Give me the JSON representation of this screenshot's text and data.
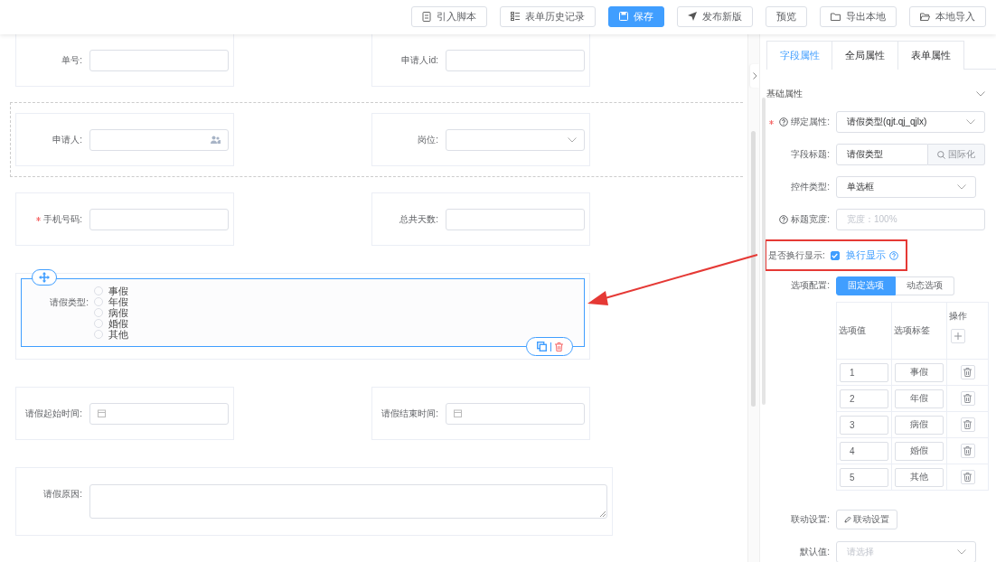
{
  "toolbar": {
    "buttons": [
      {
        "label": "引入脚本",
        "kind": "script",
        "primary": false
      },
      {
        "label": "表单历史记录",
        "kind": "history",
        "primary": false
      },
      {
        "label": "保存",
        "kind": "save",
        "primary": true
      },
      {
        "label": "发布新版",
        "kind": "publish",
        "primary": false
      },
      {
        "label": "预览",
        "kind": "none",
        "primary": false
      },
      {
        "label": "导出本地",
        "kind": "folder",
        "primary": false
      },
      {
        "label": "本地导入",
        "kind": "folder-open",
        "primary": false
      }
    ]
  },
  "canvas": {
    "rows": [
      {
        "kind": "row",
        "fields": [
          {
            "label": "单号:",
            "required": false,
            "kind": "input",
            "selected": false
          },
          {
            "label": "申请人id:",
            "required": false,
            "kind": "input",
            "selected": false
          }
        ]
      },
      {
        "kind": "container",
        "fields": [
          {
            "label": "申请人:",
            "required": false,
            "kind": "user",
            "selected": false
          },
          {
            "label": "岗位:",
            "required": false,
            "kind": "select",
            "selected": false
          }
        ]
      },
      {
        "kind": "row",
        "fields": [
          {
            "label": "手机号码:",
            "required": true,
            "kind": "input",
            "selected": false
          },
          {
            "label": "总共天数:",
            "required": false,
            "kind": "input",
            "selected": false
          }
        ]
      },
      {
        "kind": "row",
        "fields": [
          {
            "label": "请假类型:",
            "required": false,
            "kind": "radio",
            "selected": true,
            "options": [
              {
                "label": "事假",
                "checked": false
              },
              {
                "label": "年假",
                "checked": false
              },
              {
                "label": "病假",
                "checked": false
              },
              {
                "label": "婚假",
                "checked": false
              },
              {
                "label": "其他",
                "checked": false
              }
            ]
          }
        ]
      },
      {
        "kind": "row",
        "fields": [
          {
            "label": "请假起始时间:",
            "required": false,
            "kind": "date",
            "selected": false
          },
          {
            "label": "请假结束时间:",
            "required": false,
            "kind": "date",
            "selected": false
          }
        ]
      },
      {
        "kind": "row",
        "fields": [
          {
            "label": "请假原因:",
            "required": false,
            "kind": "textarea",
            "selected": false
          }
        ]
      }
    ]
  },
  "panel": {
    "tabs": [
      {
        "label": "字段属性",
        "selected": true
      },
      {
        "label": "全局属性",
        "selected": false
      },
      {
        "label": "表单属性",
        "selected": false
      }
    ],
    "section": {
      "title": "基础属性",
      "expanded": true
    },
    "props": [
      {
        "kind": "select",
        "label": "绑定属性:",
        "required": true,
        "help": true,
        "value": "请假类型(qjt.qj_qjlx)"
      },
      {
        "kind": "addon",
        "label": "字段标题:",
        "required": false,
        "help": false,
        "value": "请假类型",
        "addon": "国际化"
      },
      {
        "kind": "select",
        "label": "控件类型:",
        "required": false,
        "help": false,
        "value": "单选框"
      },
      {
        "kind": "input",
        "label": "标题宽度:",
        "required": false,
        "help": true,
        "placeholder": "宽度：100%"
      },
      {
        "kind": "checkbox",
        "label": "是否换行显示:",
        "required": false,
        "help": false,
        "checked": true,
        "text": "换行显示",
        "highlighted": true
      },
      {
        "kind": "segmented",
        "label": "选项配置:",
        "required": false,
        "help": false,
        "segments": [
          {
            "label": "固定选项",
            "selected": true
          },
          {
            "label": "动态选项",
            "selected": false
          }
        ]
      },
      {
        "kind": "options",
        "columns": [
          "选项值",
          "选项标签",
          "操作"
        ],
        "rows": [
          {
            "value": "1",
            "label": "事假"
          },
          {
            "value": "2",
            "label": "年假"
          },
          {
            "value": "3",
            "label": "病假"
          },
          {
            "value": "4",
            "label": "婚假"
          },
          {
            "value": "5",
            "label": "其他"
          }
        ]
      },
      {
        "kind": "button",
        "label": "联动设置:",
        "required": false,
        "help": false,
        "button": "联动设置"
      },
      {
        "kind": "select",
        "label": "默认值:",
        "required": false,
        "help": false,
        "placeholder": "请选择"
      }
    ]
  }
}
